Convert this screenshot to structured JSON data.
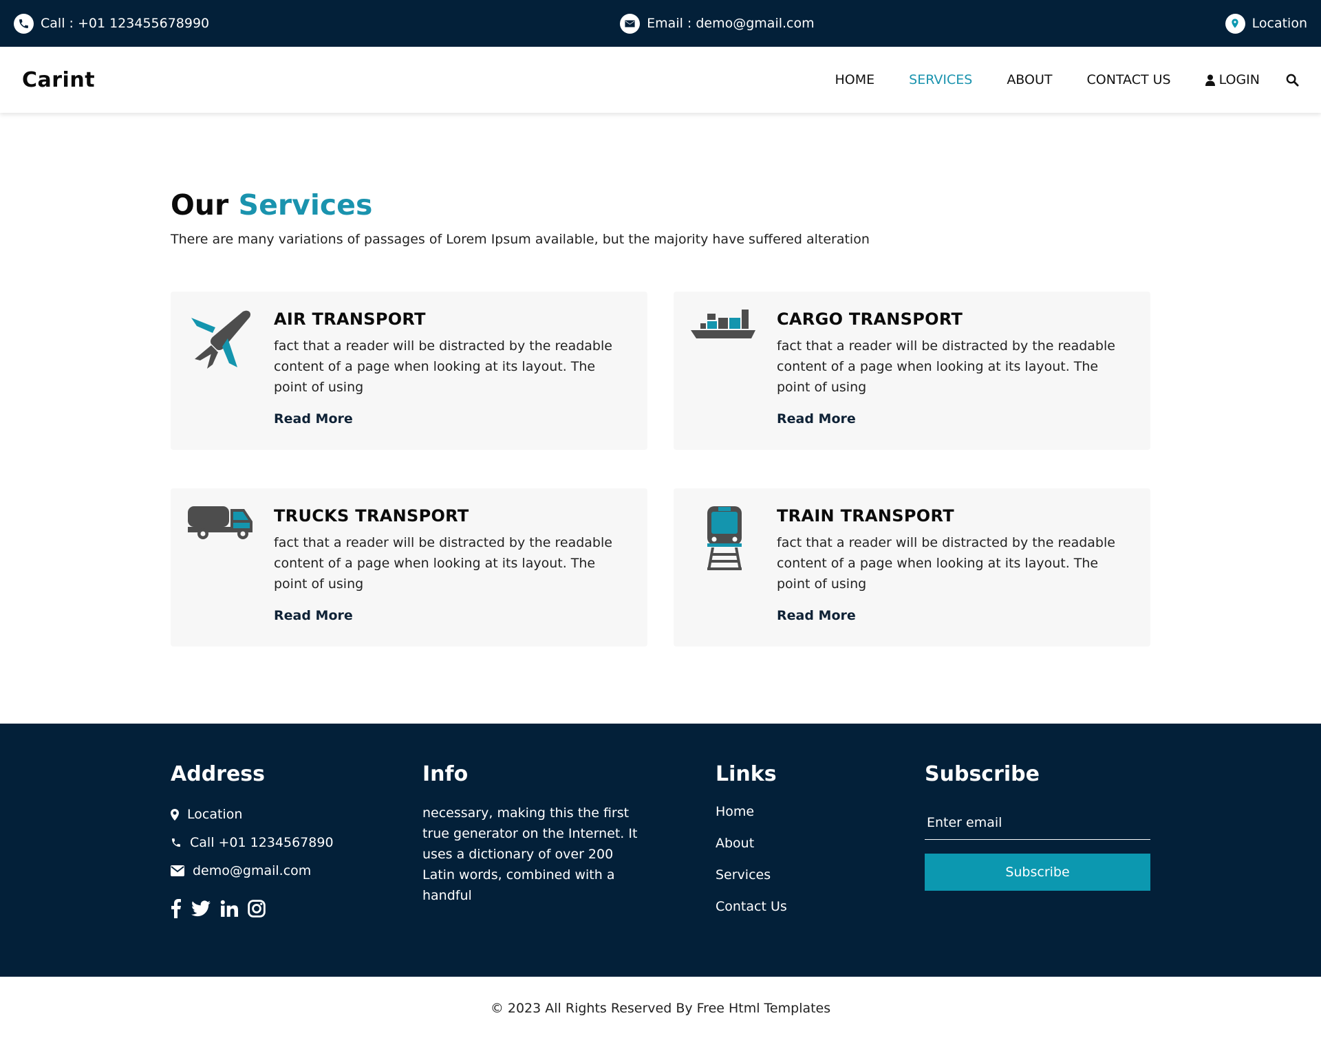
{
  "topbar": {
    "call": "Call : +01 123455678990",
    "email": "Email : demo@gmail.com",
    "location": "Location"
  },
  "nav": {
    "brand": "Carint",
    "items": [
      {
        "label": "HOME"
      },
      {
        "label": "SERVICES",
        "active": true
      },
      {
        "label": "ABOUT"
      },
      {
        "label": "CONTACT US"
      },
      {
        "label": "LOGIN"
      }
    ]
  },
  "services": {
    "heading_part1": "Our",
    "heading_part2": "Services",
    "subtitle": "There are many variations of passages of Lorem Ipsum available, but the majority have suffered alteration",
    "cards": [
      {
        "title": "AIR TRANSPORT",
        "text": "fact that a reader will be distracted by the readable content of a page when looking at its layout. The point of using",
        "link": "Read More",
        "icon": "airplane-icon"
      },
      {
        "title": "CARGO TRANSPORT",
        "text": "fact that a reader will be distracted by the readable content of a page when looking at its layout. The point of using",
        "link": "Read More",
        "icon": "cargo-ship-icon"
      },
      {
        "title": "TRUCKS TRANSPORT",
        "text": "fact that a reader will be distracted by the readable content of a page when looking at its layout. The point of using",
        "link": "Read More",
        "icon": "truck-icon"
      },
      {
        "title": "TRAIN TRANSPORT",
        "text": "fact that a reader will be distracted by the readable content of a page when looking at its layout. The point of using",
        "link": "Read More",
        "icon": "train-icon"
      }
    ]
  },
  "footer": {
    "address": {
      "title": "Address",
      "location": "Location",
      "phone": "Call +01 1234567890",
      "email": "demo@gmail.com"
    },
    "info": {
      "title": "Info",
      "text": "necessary, making this the first true generator on the Internet. It uses a dictionary of over 200 Latin words, combined with a handful"
    },
    "links": {
      "title": "Links",
      "items": [
        "Home",
        "About",
        "Services",
        "Contact Us"
      ]
    },
    "subscribe": {
      "title": "Subscribe",
      "placeholder": "Enter email",
      "button": "Subscribe"
    }
  },
  "copyright": "© 2023 All Rights Reserved By Free Html Templates",
  "colors": {
    "dark_navy": "#032039",
    "accent": "#1a93ae",
    "button": "#0c98b0",
    "icon_gray": "#4d4d4d"
  }
}
